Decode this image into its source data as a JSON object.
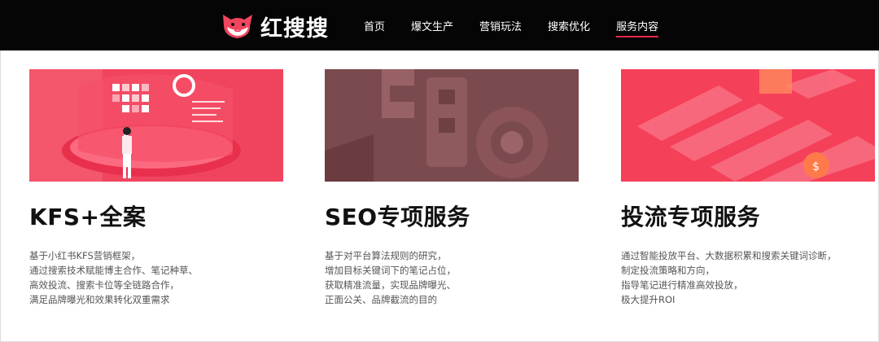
{
  "header": {
    "logo_text": "红搜搜",
    "logo_icon": "fox-mascot-icon",
    "nav": [
      {
        "label": "首页"
      },
      {
        "label": "爆文生产"
      },
      {
        "label": "营销玩法"
      },
      {
        "label": "搜索优化"
      },
      {
        "label": "服务内容",
        "active": true
      }
    ]
  },
  "colors": {
    "topbar": "#050505",
    "accent": "#e8294a",
    "card1_bg": "#f0445e",
    "card2_bg": "#7a4a4e",
    "card3_bg": "#f5405a"
  },
  "cards": [
    {
      "title": "KFS+全案",
      "image_icon": "marketing-illustration-icon",
      "desc": [
        "基于小红书KFS营销框架，",
        "通过搜索技术赋能博主合作、笔记种草、",
        "高效投流、搜索卡位等全链路合作，",
        "满足品牌曝光和效果转化双重需求"
      ]
    },
    {
      "title": "SEO专项服务",
      "image_icon": "seo-letters-illustration-icon",
      "desc": [
        "基于对平台算法规则的研究，",
        "增加目标关键词下的笔记占位，",
        "获取精准流量，实现品牌曝光、",
        "正面公关、品牌截流的目的"
      ]
    },
    {
      "title": "投流专项服务",
      "image_icon": "ad-analytics-illustration-icon",
      "desc": [
        "通过智能投放平台、大数据积累和搜索关键词诊断，",
        "制定投流策略和方向，",
        "指导笔记进行精准高效投放，",
        "极大提升ROI"
      ]
    }
  ]
}
